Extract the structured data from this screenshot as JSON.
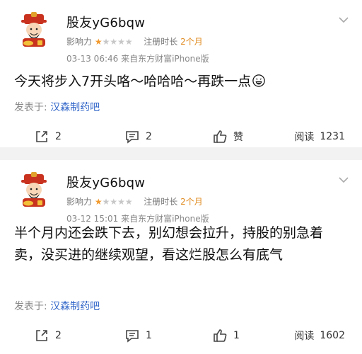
{
  "posts": [
    {
      "username": "股友yG6bqw",
      "influence_label": "影响力",
      "influence_stars": 1,
      "influence_max": 5,
      "reg_label": "注册时长",
      "reg_value": "2个月",
      "time": "03-13 06:46",
      "client": "来自东方财富iPhone版",
      "content": "今天将步入7开头咯～哈哈哈～再跌一点",
      "content_emoji": "grinning-face-emoji",
      "source_label": "发表于:",
      "source_bar": "汉森制药吧",
      "actions": {
        "share_count": "2",
        "comment_count": "2",
        "like_label": "赞",
        "read_label": "阅读",
        "read_count": "1231"
      }
    },
    {
      "username": "股友yG6bqw",
      "influence_label": "影响力",
      "influence_stars": 1,
      "influence_max": 5,
      "reg_label": "注册时长",
      "reg_value": "2个月",
      "time": "03-12 15:01",
      "client": "来自东方财富iPhone版",
      "content": "半个月内还会跌下去，别幻想会拉升，持股的别急着卖，没买进的继续观望，看这烂股怎么有底气",
      "source_label": "发表于:",
      "source_bar": "汉森制药吧",
      "actions": {
        "share_count": "2",
        "comment_count": "1",
        "like_count": "1",
        "read_label": "阅读",
        "read_count": "1602"
      }
    }
  ],
  "colors": {
    "accent_orange": "#e08a1e",
    "star_on": "#f29a2e",
    "link_blue": "#2f64c8",
    "divider": "#f2f2f2"
  },
  "icons": [
    "caishen-avatar-icon",
    "chevron-down-icon",
    "share-icon",
    "comment-icon",
    "thumbs-up-icon",
    "grinning-face-emoji"
  ]
}
